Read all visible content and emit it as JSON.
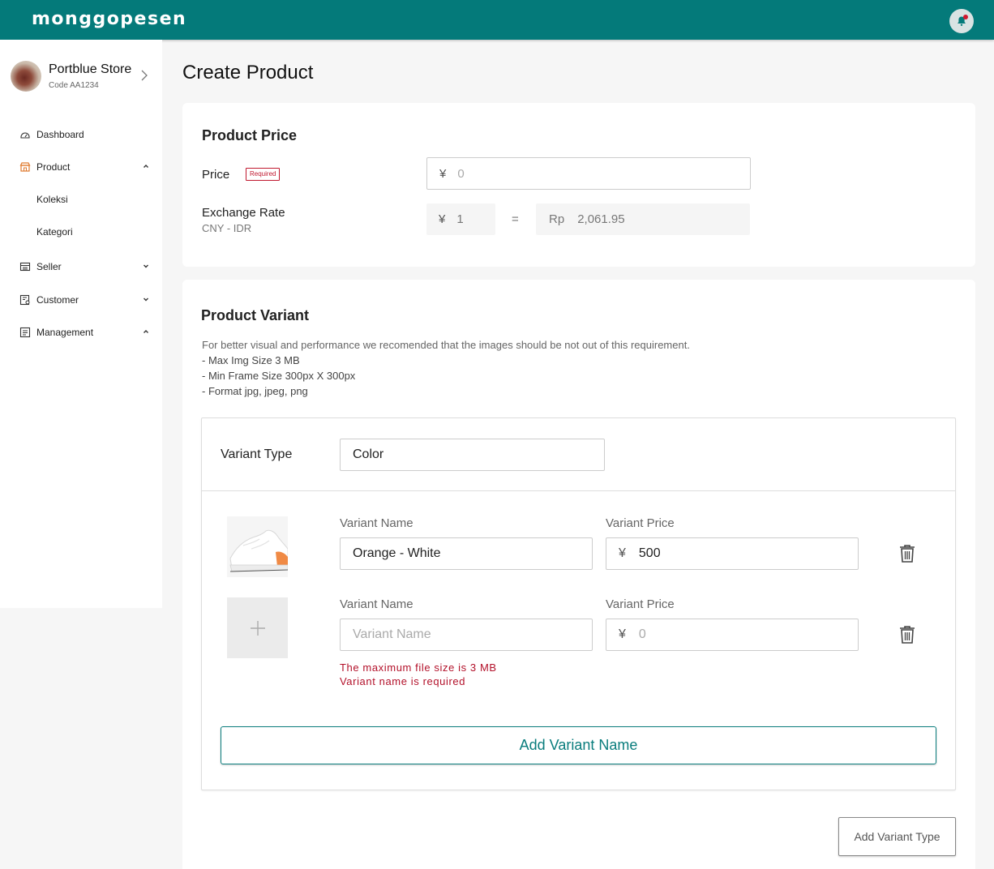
{
  "brand": {
    "logo_text": "monggopesen",
    "accent": "#047a7a",
    "error_color": "#b3112a"
  },
  "header": {
    "notification_icon": "bell-icon"
  },
  "store": {
    "name": "Portblue Store",
    "code": "Code AA1234"
  },
  "sidebar": {
    "dashboard": "Dashboard",
    "product": "Product",
    "product_sub": [
      "Koleksi",
      "Kategori"
    ],
    "seller": "Seller",
    "customer": "Customer",
    "management": "Management"
  },
  "page": {
    "title": "Create Product"
  },
  "product_price": {
    "title": "Product Price",
    "price_label": "Price",
    "required_badge": "Required",
    "currency_symbol": "¥",
    "price_placeholder": "0",
    "exchange_label": "Exchange Rate",
    "exchange_sub": "CNY - IDR",
    "rate_from": "1",
    "equals": "=",
    "rate_to_symbol": "Rp",
    "rate_to_value": "2,061.95"
  },
  "product_variant": {
    "title": "Product Variant",
    "desc_lines": [
      "For better visual and performance we recomended that the images should be not out of this requirement.",
      "- Max Img Size 3 MB",
      "- Min Frame Size 300px X 300px",
      "- Format jpg, jpeg, png"
    ],
    "variant_type_label": "Variant Type",
    "variant_type_value": "Color",
    "variant_name_label": "Variant Name",
    "variant_price_label": "Variant Price",
    "rows": [
      {
        "name": "Orange - White",
        "currency": "¥",
        "price": "500"
      },
      {
        "name_placeholder": "Variant Name",
        "currency": "¥",
        "price_placeholder": "0"
      }
    ],
    "errors": [
      "The maximum file size is 3 MB",
      "Variant name is required"
    ],
    "add_variant_name": "Add Variant Name",
    "add_variant_type": "Add Variant Type"
  }
}
